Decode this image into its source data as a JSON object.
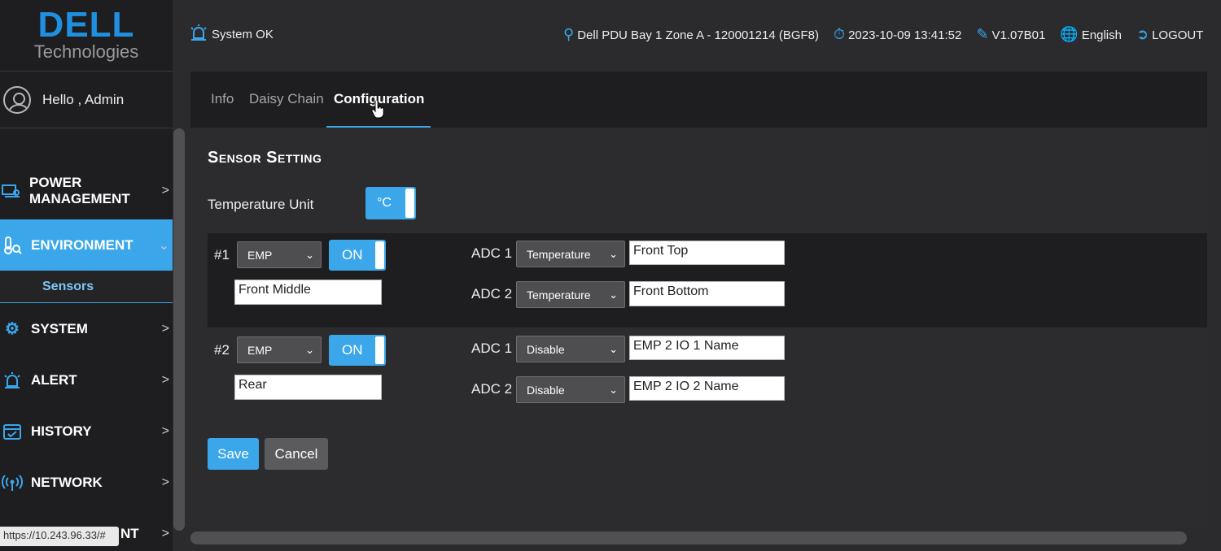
{
  "brand": {
    "logo_mark": "DELL",
    "logo_sub": "Technologies"
  },
  "user": {
    "greeting": "Hello , Admin"
  },
  "nav": {
    "power_management": "POWER MANAGEMENT",
    "environment": "ENVIRONMENT",
    "sensors": "Sensors",
    "system": "SYSTEM",
    "alert": "ALERT",
    "history": "HISTORY",
    "network": "NETWORK",
    "partial_item": "NT"
  },
  "header": {
    "status": "System OK",
    "device": "Dell PDU Bay 1 Zone A - 120001214 (BGF8)",
    "datetime": "2023-10-09 13:41:52",
    "version": "V1.07B01",
    "language": "English",
    "logout": "LOGOUT"
  },
  "tabs": {
    "info": "Info",
    "daisy_chain": "Daisy Chain",
    "configuration": "Configuration"
  },
  "sensor_setting": {
    "title": "Sensor Setting",
    "temperature_unit_label": "Temperature Unit",
    "temperature_unit_value": "°C",
    "sensors": [
      {
        "index": "#1",
        "type": "EMP",
        "state": "ON",
        "name": "Front Middle",
        "adc1_label": "ADC 1",
        "adc1_type": "Temperature",
        "adc1_name": "Front Top",
        "adc2_label": "ADC 2",
        "adc2_type": "Temperature",
        "adc2_name": "Front Bottom"
      },
      {
        "index": "#2",
        "type": "EMP",
        "state": "ON",
        "name": "Rear",
        "adc1_label": "ADC 1",
        "adc1_type": "Disable",
        "adc1_name": "EMP 2 IO 1 Name",
        "adc2_label": "ADC 2",
        "adc2_type": "Disable",
        "adc2_name": "EMP 2 IO 2 Name"
      }
    ],
    "save": "Save",
    "cancel": "Cancel"
  },
  "status_bar": {
    "url": "https://10.243.96.33/#"
  },
  "colors": {
    "accent": "#3ba7ea",
    "sidebar": "#1e1e20",
    "background": "#2b2b2d"
  }
}
